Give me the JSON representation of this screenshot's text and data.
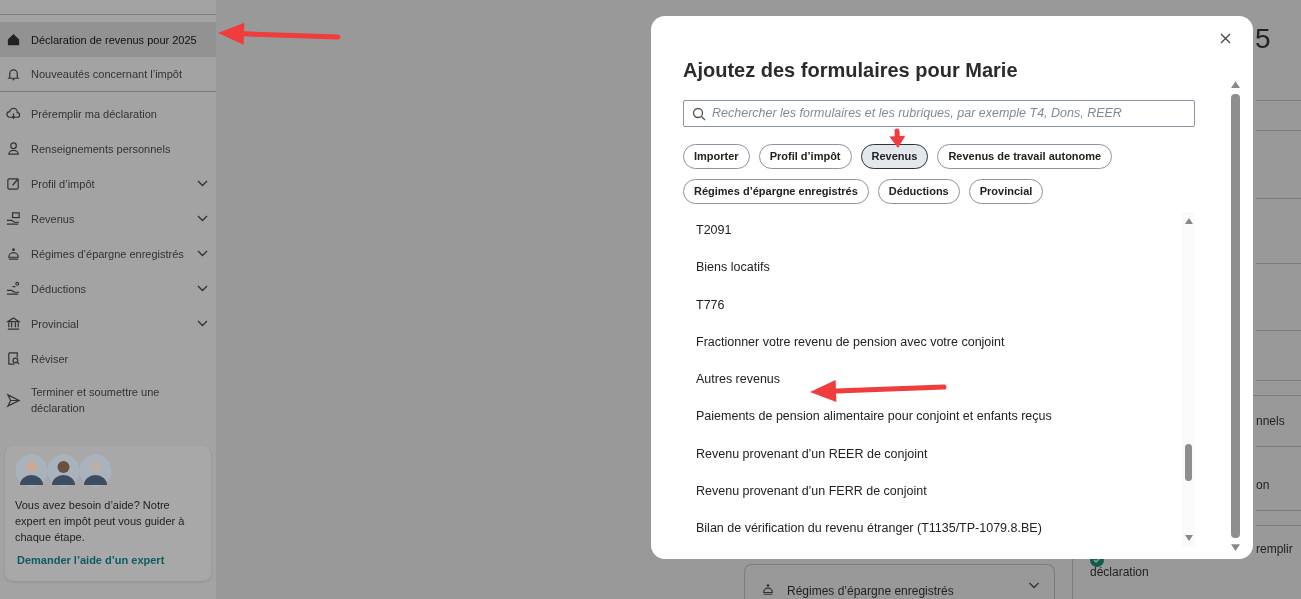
{
  "sidebar": {
    "items": [
      {
        "label": "Déclaration de revenus pour 2025",
        "selected": true,
        "expandable": false,
        "divider_after": false
      },
      {
        "label": "Nouveautés concernant l’impôt",
        "selected": false,
        "expandable": false,
        "divider_after": true
      },
      {
        "label": "Préremplir ma déclaration",
        "selected": false,
        "expandable": false,
        "divider_after": false
      },
      {
        "label": "Renseignements personnels",
        "selected": false,
        "expandable": false,
        "divider_after": false
      },
      {
        "label": "Profil d’impôt",
        "selected": false,
        "expandable": true,
        "divider_after": false
      },
      {
        "label": "Revenus",
        "selected": false,
        "expandable": true,
        "divider_after": false
      },
      {
        "label": "Régimes d’épargne enregistrés",
        "selected": false,
        "expandable": true,
        "divider_after": false
      },
      {
        "label": "Déductions",
        "selected": false,
        "expandable": true,
        "divider_after": false
      },
      {
        "label": "Provincial",
        "selected": false,
        "expandable": true,
        "divider_after": false
      },
      {
        "label": "Réviser",
        "selected": false,
        "expandable": false,
        "divider_after": false
      },
      {
        "label": "Terminer et soumettre une déclaration",
        "selected": false,
        "expandable": false,
        "divider_after": false
      }
    ],
    "help_card": {
      "text": "Vous avez besoin d’aide? Notre expert en impôt peut vous guider à chaque étape.",
      "link": "Demander l’aide d’un expert"
    }
  },
  "background": {
    "heading": "5",
    "fragments": [
      "nnels",
      "on",
      "remplir"
    ],
    "checked_item": "déclaration",
    "card": "Régimes d’épargne enregistrés"
  },
  "modal": {
    "title": "Ajoutez des formulaires pour Marie",
    "search": {
      "placeholder": "Rechercher les formulaires et les rubriques, par exemple T4, Dons, REER"
    },
    "chips": [
      {
        "label": "Importer",
        "selected": false
      },
      {
        "label": "Profil d’impôt",
        "selected": false
      },
      {
        "label": "Revenus",
        "selected": true
      },
      {
        "label": "Revenus de travail autonome",
        "selected": false
      },
      {
        "label": "Régimes d’épargne enregistrés",
        "selected": false
      },
      {
        "label": "Déductions",
        "selected": false
      },
      {
        "label": "Provincial",
        "selected": false
      }
    ],
    "forms": [
      "T2091",
      "Biens locatifs",
      "T776",
      "Fractionner votre revenu de pension avec votre conjoint",
      "Autres revenus",
      "Paiements de pension alimentaire pour conjoint et enfants reçus",
      "Revenu provenant d’un REER de conjoint",
      "Revenu provenant d’un FERR de conjoint",
      "Bilan de vérification du revenu étranger (T1135/TP-1079.8.BE)"
    ]
  }
}
